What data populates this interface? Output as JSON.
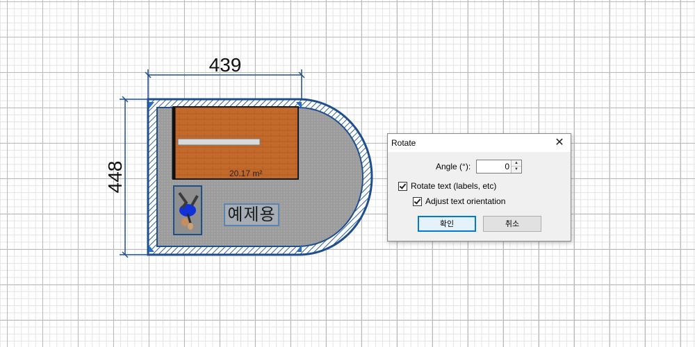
{
  "plan": {
    "width_dimension": "439",
    "height_dimension": "448",
    "area_label": "20.17 m²",
    "room_name": "예제용"
  },
  "dialog": {
    "title": "Rotate",
    "angle_label": "Angle (°):",
    "angle_value": "0",
    "rotate_text_label": "Rotate text (labels, etc)",
    "rotate_text_checked": true,
    "adjust_orientation_label": "Adjust text orientation",
    "adjust_orientation_checked": true,
    "ok_label": "확인",
    "cancel_label": "취소"
  },
  "colors": {
    "wall_outline": "#1f4e8c",
    "wall_hatch": "#ffffff",
    "floor": "#9b9b9b",
    "carpet": "#c0692a",
    "grid_major": "#b9b9b9",
    "grid_minor": "#e3e3e3"
  }
}
